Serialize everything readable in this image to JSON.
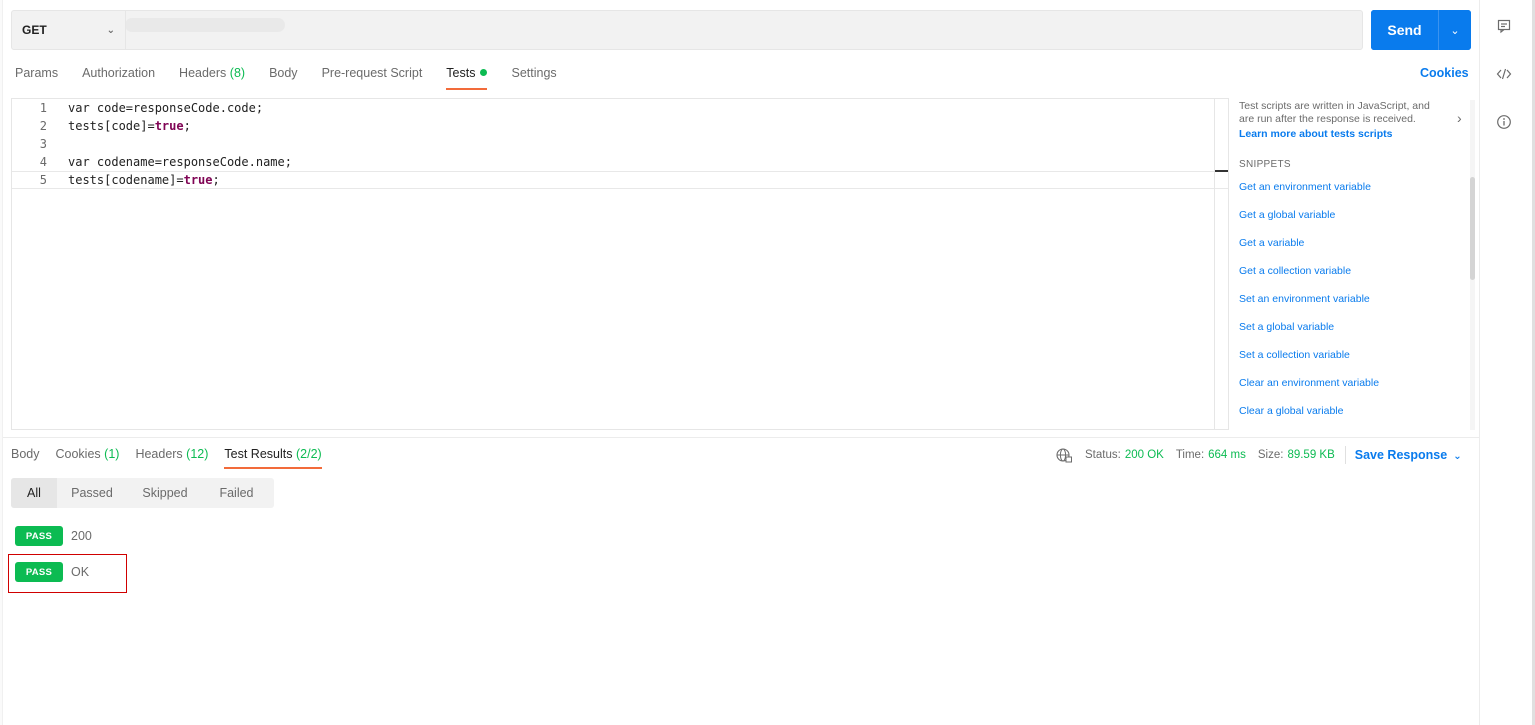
{
  "request": {
    "method": "GET",
    "url_placeholder": "",
    "send_label": "Send"
  },
  "request_tabs": [
    {
      "label": "Params",
      "count": ""
    },
    {
      "label": "Authorization",
      "count": ""
    },
    {
      "label": "Headers",
      "count": "(8)"
    },
    {
      "label": "Body",
      "count": ""
    },
    {
      "label": "Pre-request Script",
      "count": ""
    },
    {
      "label": "Tests",
      "count": ""
    },
    {
      "label": "Settings",
      "count": ""
    }
  ],
  "cookies_label": "Cookies",
  "editor": {
    "lines": [
      {
        "n": "1",
        "pre": "var code=responseCode.code;",
        "kw": "",
        "post": ""
      },
      {
        "n": "2",
        "pre": "tests[code]=",
        "kw": "true",
        "post": ";"
      },
      {
        "n": "3",
        "pre": "",
        "kw": "",
        "post": ""
      },
      {
        "n": "4",
        "pre": "var codename=responseCode.name;",
        "kw": "",
        "post": ""
      },
      {
        "n": "5",
        "pre": "tests[codename]=",
        "kw": "true",
        "post": ";"
      }
    ]
  },
  "snippets": {
    "description": "Test scripts are written in JavaScript, and are run after the response is received.",
    "learn_more": "Learn more about tests scripts",
    "heading": "SNIPPETS",
    "items": [
      "Get an environment variable",
      "Get a global variable",
      "Get a variable",
      "Get a collection variable",
      "Set an environment variable",
      "Set a global variable",
      "Set a collection variable",
      "Clear an environment variable",
      "Clear a global variable"
    ]
  },
  "response_tabs": [
    {
      "label": "Body",
      "count": ""
    },
    {
      "label": "Cookies",
      "count": "(1)"
    },
    {
      "label": "Headers",
      "count": "(12)"
    },
    {
      "label": "Test Results",
      "count": "(2/2)"
    }
  ],
  "status": {
    "status_label": "Status:",
    "status_value": "200 OK",
    "time_label": "Time:",
    "time_value": "664 ms",
    "size_label": "Size:",
    "size_value": "89.59 KB",
    "save_label": "Save Response"
  },
  "filters": [
    "All",
    "Passed",
    "Skipped",
    "Failed"
  ],
  "results": [
    {
      "badge": "PASS",
      "name": "200"
    },
    {
      "badge": "PASS",
      "name": "OK"
    }
  ],
  "colors": {
    "accent": "#097bed",
    "success": "#0cbb52",
    "active_tab": "#f26b3a",
    "highlight": "#d00000"
  }
}
